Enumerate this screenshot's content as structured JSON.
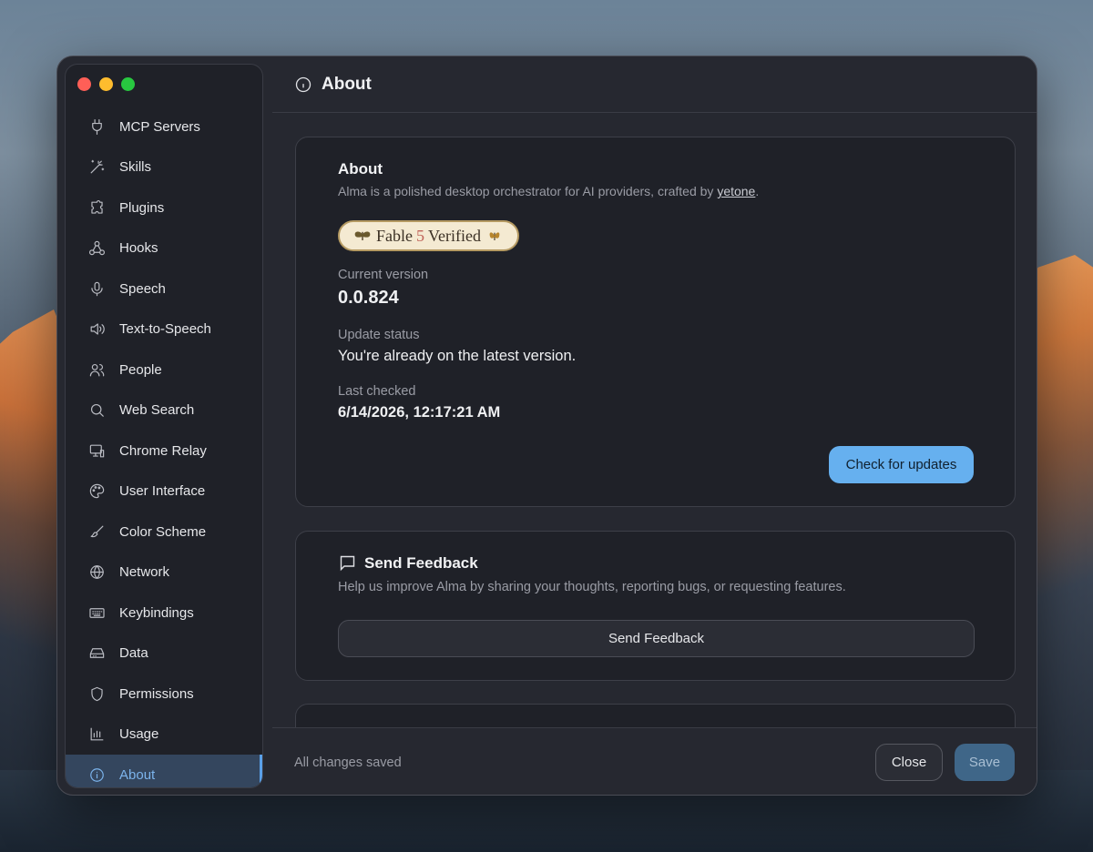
{
  "window": {
    "title": "About"
  },
  "sidebar": {
    "items": [
      {
        "label": "MCP Servers",
        "icon": "plug-icon"
      },
      {
        "label": "Skills",
        "icon": "magic-wand-icon"
      },
      {
        "label": "Plugins",
        "icon": "puzzle-icon"
      },
      {
        "label": "Hooks",
        "icon": "webhook-icon"
      },
      {
        "label": "Speech",
        "icon": "microphone-icon"
      },
      {
        "label": "Text-to-Speech",
        "icon": "speaker-icon"
      },
      {
        "label": "People",
        "icon": "people-icon"
      },
      {
        "label": "Web Search",
        "icon": "search-icon"
      },
      {
        "label": "Chrome Relay",
        "icon": "monitor-icon"
      },
      {
        "label": "User Interface",
        "icon": "palette-icon"
      },
      {
        "label": "Color Scheme",
        "icon": "brush-icon"
      },
      {
        "label": "Network",
        "icon": "globe-icon"
      },
      {
        "label": "Keybindings",
        "icon": "keyboard-icon"
      },
      {
        "label": "Data",
        "icon": "drive-icon"
      },
      {
        "label": "Permissions",
        "icon": "shield-icon"
      },
      {
        "label": "Usage",
        "icon": "bar-chart-icon"
      },
      {
        "label": "About",
        "icon": "info-icon",
        "active": true
      }
    ]
  },
  "header": {
    "title": "About"
  },
  "about": {
    "title": "About",
    "description_prefix": "Alma is a polished desktop orchestrator for AI providers, crafted by ",
    "author_link": "yetone",
    "description_suffix": ".",
    "badge": {
      "word1": "Fable",
      "number": "5",
      "word2": "Verified"
    },
    "current_version_label": "Current version",
    "current_version": "0.0.824",
    "update_status_label": "Update status",
    "update_status": "You're already on the latest version.",
    "last_checked_label": "Last checked",
    "last_checked": "6/14/2026, 12:17:21 AM",
    "check_button": "Check for updates"
  },
  "feedback": {
    "title": "Send Feedback",
    "description": "Help us improve Alma by sharing your thoughts, reporting bugs, or requesting features.",
    "button": "Send Feedback"
  },
  "footer": {
    "status": "All changes saved",
    "close_label": "Close",
    "save_label": "Save"
  },
  "colors": {
    "accent": "#66b0ef",
    "active_nav_bg": "#34465e",
    "active_nav_text": "#7cb4ec",
    "save_button": "#3f6688"
  }
}
